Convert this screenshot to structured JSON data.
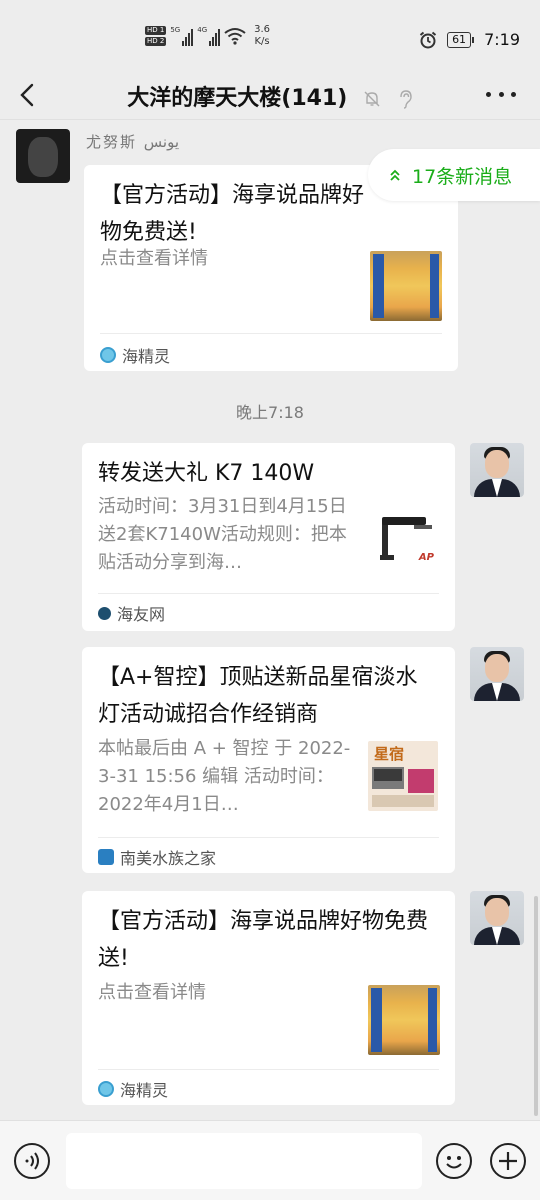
{
  "status_bar": {
    "hd1": "HD 1",
    "hd2": "HD 2",
    "net1": "5G",
    "net2": "4G",
    "speed_value": "3.6",
    "speed_unit": "K/s",
    "battery": "61",
    "time": "7:19"
  },
  "header": {
    "title": "大洋的摩天大楼(141)",
    "back_icon": "chevron-left-icon",
    "mute_icon": "bell-off-icon",
    "ear_icon": "earpiece-icon",
    "more_icon": "more-icon"
  },
  "new_messages": {
    "label": "17条新消息",
    "accent": "#1aad19"
  },
  "timestamp": "晚上7:18",
  "messages": [
    {
      "sender": "尤努斯  يونس",
      "title": "【官方活动】海享说品牌好物免费送!",
      "desc": "点击查看详情",
      "source": "海精灵"
    },
    {
      "title": "转发送大礼 K7 140W",
      "desc": "活动时间：3月31日到4月15日送2套K7140W活动规则：把本贴活动分享到海…",
      "source": "海友网",
      "thumb_text": "AP"
    },
    {
      "title": "【A+智控】顶贴送新品星宿淡水灯活动诚招合作经销商",
      "desc": "本帖最后由 A + 智控 于 2022-3-31 15:56 编辑 活动时间：2022年4月1日…",
      "source": "南美水族之家",
      "thumb_text": "星宿"
    },
    {
      "title": "【官方活动】海享说品牌好物免费送!",
      "desc": "点击查看详情",
      "source": "海精灵"
    }
  ],
  "input_bar": {
    "voice_icon": "voice-icon",
    "emoji_icon": "emoji-icon",
    "plus_icon": "plus-icon"
  }
}
